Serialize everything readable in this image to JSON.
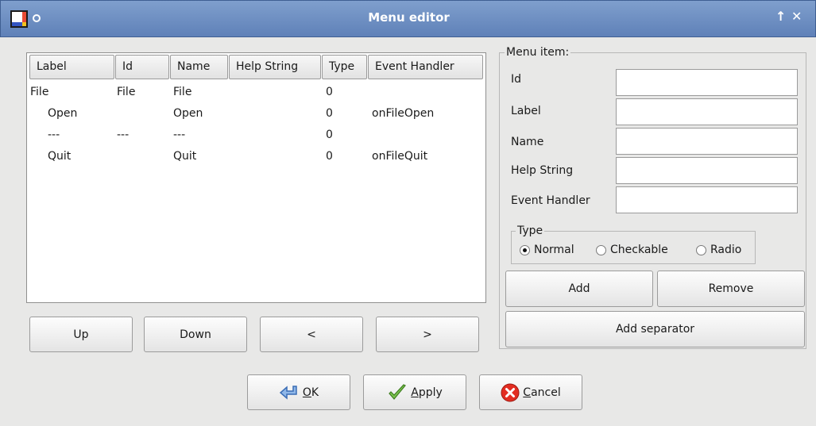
{
  "window": {
    "title": "Menu editor"
  },
  "menu_list": {
    "columns": [
      "Label",
      "Id",
      "Name",
      "Help String",
      "Type",
      "Event Handler"
    ],
    "rows": [
      {
        "label": "File",
        "id": "File",
        "name": "File",
        "help": "",
        "type": "0",
        "handler": ""
      },
      {
        "label": "Open",
        "id": "",
        "name": "Open",
        "help": "",
        "type": "0",
        "handler": "onFileOpen"
      },
      {
        "label": "---",
        "id": "---",
        "name": "---",
        "help": "",
        "type": "0",
        "handler": ""
      },
      {
        "label": "Quit",
        "id": "",
        "name": "Quit",
        "help": "",
        "type": "0",
        "handler": "onFileQuit"
      }
    ]
  },
  "move_buttons": {
    "up": "Up",
    "down": "Down",
    "left": "<",
    "right": ">"
  },
  "menu_item": {
    "title": "Menu item:",
    "fields": {
      "id": {
        "label": "Id",
        "value": ""
      },
      "label": {
        "label": "Label",
        "value": ""
      },
      "name": {
        "label": "Name",
        "value": ""
      },
      "help": {
        "label": "Help String",
        "value": ""
      },
      "handler": {
        "label": "Event Handler",
        "value": ""
      }
    },
    "type": {
      "title": "Type",
      "options": [
        "Normal",
        "Checkable",
        "Radio"
      ],
      "selected": "Normal"
    },
    "add": "Add",
    "remove": "Remove",
    "add_separator": "Add separator"
  },
  "dialog_buttons": {
    "ok_mnemonic": "O",
    "ok_rest": "K",
    "apply_mnemonic": "A",
    "apply_rest": "pply",
    "cancel_mnemonic": "C",
    "cancel_rest": "ancel"
  },
  "colors": {
    "titlebar": "#6b8cc0",
    "window_bg": "#e8e8e7"
  },
  "icons": [
    "app-icon",
    "shade-icon",
    "maximize-icon",
    "close-icon",
    "ok-arrow-icon",
    "apply-check-icon",
    "cancel-x-icon"
  ]
}
